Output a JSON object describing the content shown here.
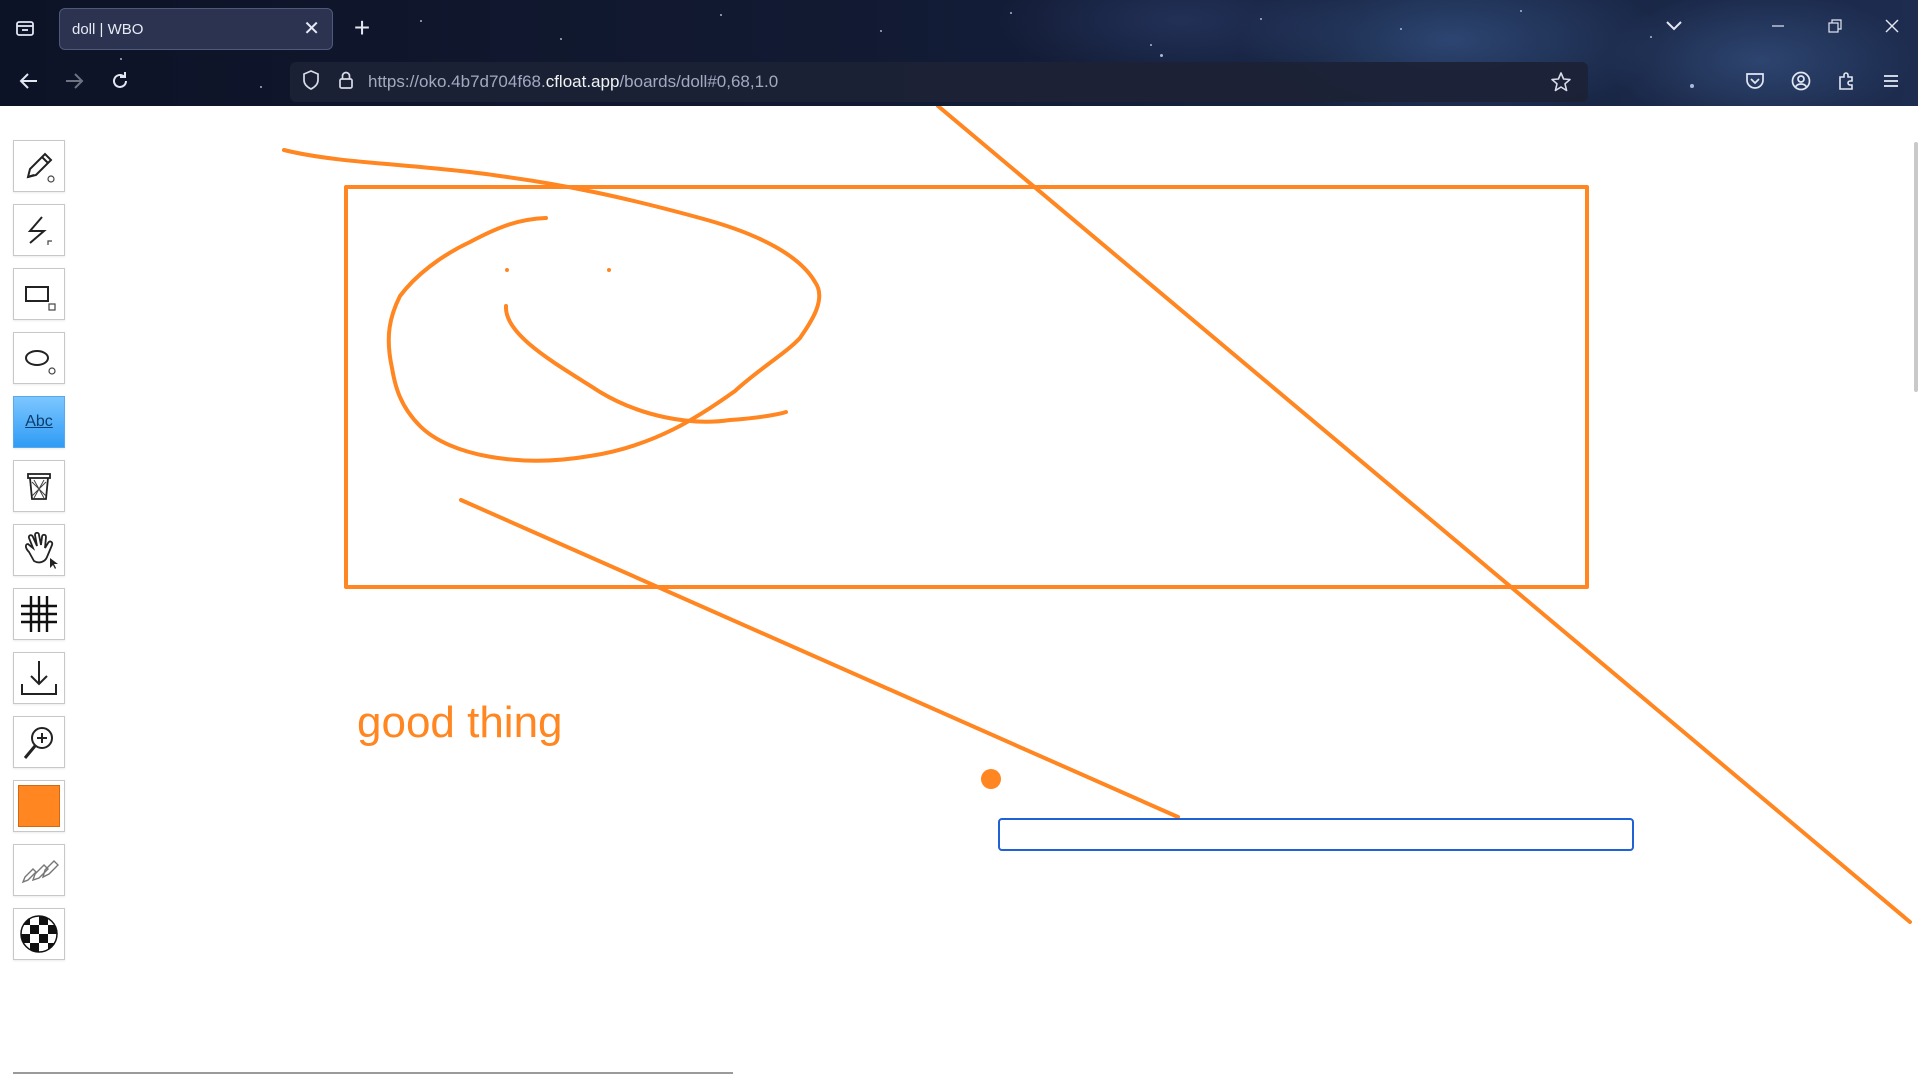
{
  "browser": {
    "tab_title": "doll | WBO",
    "tab_close": "✕",
    "new_tab": "+",
    "url_prefix": "https://oko.4b7d704f68.",
    "url_host": "cfloat.app",
    "url_suffix": "/boards/doll#0,68,1.0"
  },
  "toolbar": {
    "tools": [
      {
        "name": "pencil-tool",
        "icon": "pencil-icon"
      },
      {
        "name": "straight-line-tool",
        "icon": "line-icon"
      },
      {
        "name": "rectangle-tool",
        "icon": "rectangle-icon"
      },
      {
        "name": "ellipse-tool",
        "icon": "ellipse-icon"
      },
      {
        "name": "text-tool",
        "icon": "text-icon",
        "label": "Abc",
        "active": true
      },
      {
        "name": "eraser-tool",
        "icon": "trash-icon"
      },
      {
        "name": "hand-tool",
        "icon": "hand-icon"
      },
      {
        "name": "grid-tool",
        "icon": "grid-icon"
      },
      {
        "name": "download-tool",
        "icon": "download-icon"
      },
      {
        "name": "zoom-tool",
        "icon": "zoom-icon"
      }
    ],
    "color": "#ff8620"
  },
  "canvas": {
    "stroke_color": "#ff8620",
    "text": "good thing",
    "input_value": ""
  }
}
